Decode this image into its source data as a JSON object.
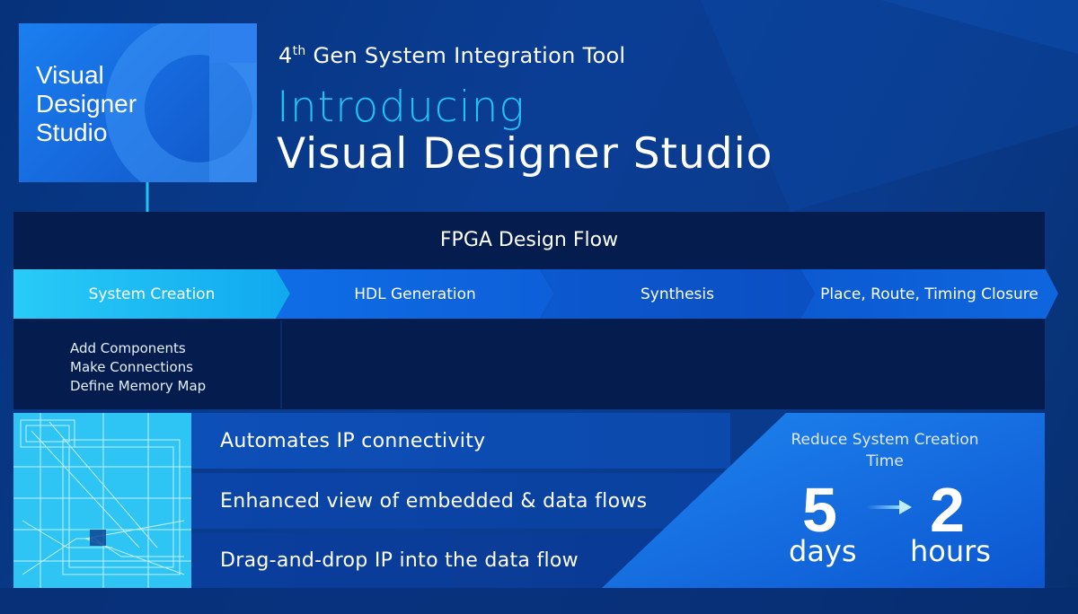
{
  "header": {
    "logo_text": "Visual\nDesigner\nStudio",
    "subtitle_prefix": "4",
    "subtitle_ordinal": "th",
    "subtitle_rest": " Gen System Integration Tool",
    "heading_line1": "Introducing",
    "heading_line2": "Visual Designer Studio"
  },
  "flow": {
    "title": "FPGA Design Flow",
    "steps": [
      {
        "label": "System Creation"
      },
      {
        "label": "HDL Generation"
      },
      {
        "label": "Synthesis"
      },
      {
        "label": "Place, Route, Timing Closure"
      }
    ],
    "tasks": [
      "Add Components",
      "Make Connections",
      "Define Memory Map"
    ]
  },
  "benefits": [
    "Automates IP connectivity",
    "Enhanced view of embedded & data flows",
    "Drag-and-drop IP into the data flow"
  ],
  "time_reduction": {
    "title": "Reduce System Creation Time",
    "from_value": "5",
    "from_unit": "days",
    "to_value": "2",
    "to_unit": "hours"
  },
  "colors": {
    "background": "#0a3e95",
    "accent_cyan": "#22c3f2",
    "panel_dark": "#041d4e",
    "step_active": "#1ec0f5",
    "step_blue": "#0e5fdc"
  }
}
